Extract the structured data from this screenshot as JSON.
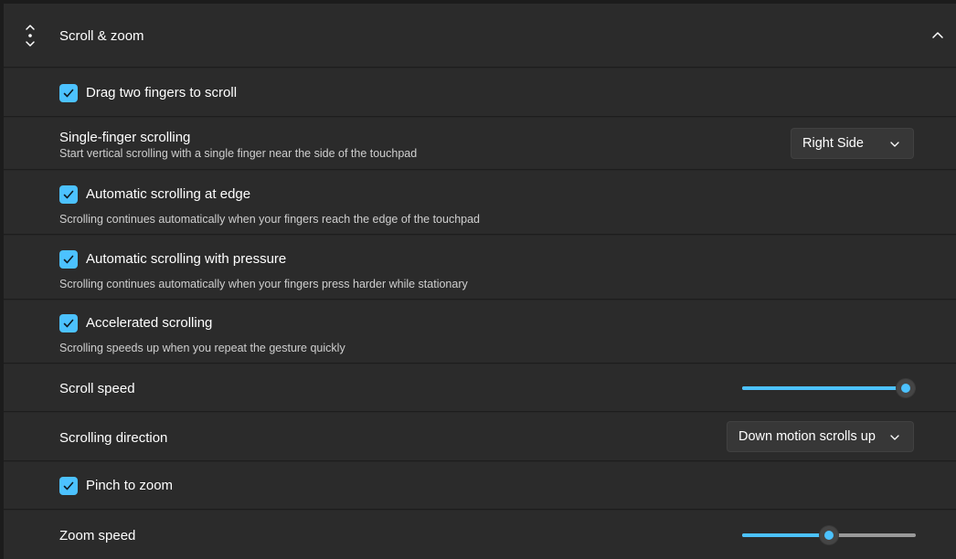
{
  "header": {
    "title": "Scroll & zoom",
    "icon": "scroll-arrows-icon",
    "collapse_icon": "chevron-up-icon"
  },
  "rows": {
    "drag_two": {
      "label": "Drag two fingers to scroll",
      "checked": true
    },
    "single_finger": {
      "label": "Single-finger scrolling",
      "desc": "Start vertical scrolling with a single finger near the side of the touchpad",
      "value": "Right Side"
    },
    "auto_edge": {
      "label": "Automatic scrolling at edge",
      "desc": "Scrolling continues automatically when your fingers reach the edge of the touchpad",
      "checked": true
    },
    "auto_pressure": {
      "label": "Automatic scrolling with pressure",
      "desc": "Scrolling continues automatically when your fingers press harder while stationary",
      "checked": true
    },
    "accelerated": {
      "label": "Accelerated scrolling",
      "desc": "Scrolling speeds up when you repeat the gesture quickly",
      "checked": true
    },
    "scroll_speed": {
      "label": "Scroll speed",
      "value_fraction": 0.94
    },
    "scroll_direction": {
      "label": "Scrolling direction",
      "value": "Down motion scrolls up"
    },
    "pinch": {
      "label": "Pinch to zoom",
      "checked": true
    },
    "zoom_speed": {
      "label": "Zoom speed",
      "value_fraction": 0.5
    }
  },
  "colors": {
    "accent": "#4cc2ff",
    "card": "#2b2b2b",
    "background": "#1c1c1c"
  }
}
